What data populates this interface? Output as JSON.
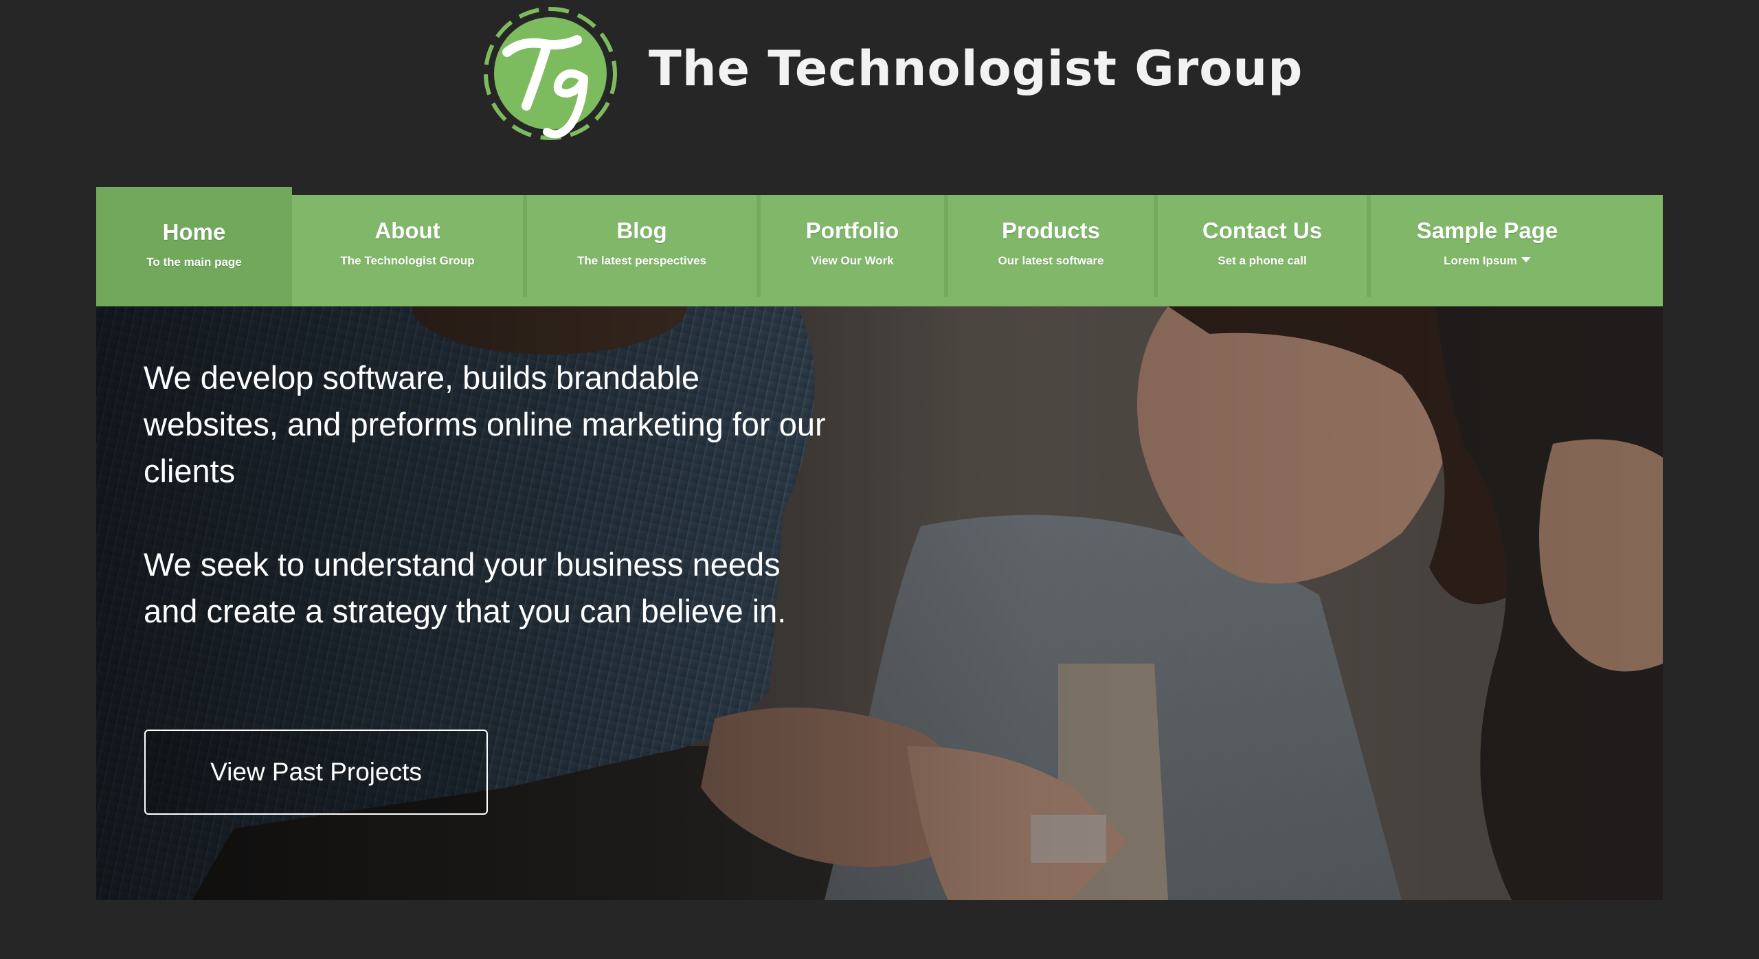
{
  "site": {
    "title": "The Technologist Group",
    "logo_letters": "Tg"
  },
  "colors": {
    "background": "#262626",
    "nav_green": "#80b768",
    "nav_active": "#72a85c",
    "text_light": "#ffffff"
  },
  "nav": {
    "items": [
      {
        "label": "Home",
        "sub": "To the main page",
        "active": true
      },
      {
        "label": "About",
        "sub": "The Technologist Group"
      },
      {
        "label": "Blog",
        "sub": "The latest perspectives"
      },
      {
        "label": "Portfolio",
        "sub": "View Our Work"
      },
      {
        "label": "Products",
        "sub": "Our latest software"
      },
      {
        "label": "Contact Us",
        "sub": "Set a phone call"
      },
      {
        "label": "Sample Page",
        "sub": "Lorem Ipsum",
        "dropdown": true,
        "icon": "caret-down-icon"
      }
    ]
  },
  "hero": {
    "paragraph_1": "We develop software, builds brandable websites, and preforms online marketing for our clients",
    "paragraph_2": "We seek to understand your business needs and create a strategy that you can believe in.",
    "button_label": "View Past Projects"
  }
}
